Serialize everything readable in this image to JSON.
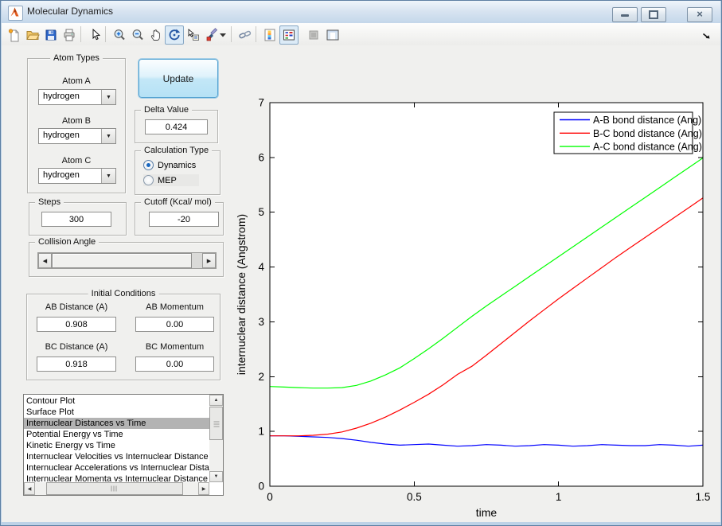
{
  "window": {
    "title": "Molecular Dynamics",
    "buttons": [
      "minimize",
      "restore",
      "close"
    ]
  },
  "toolbar": {
    "buttons": [
      "new-file",
      "open-file",
      "save",
      "print",
      "pointer",
      "zoom-in",
      "zoom-out",
      "pan",
      "rotate-3d",
      "data-cursor",
      "brush",
      "brush-dropdown",
      "link-plot",
      "insert-colorbar",
      "insert-legend",
      "hide-plot-tools",
      "show-plot-tools"
    ],
    "pressed": [
      "rotate-3d",
      "insert-legend"
    ]
  },
  "controls": {
    "atom_types": {
      "title": "Atom Types",
      "fields": [
        {
          "label": "Atom A",
          "value": "hydrogen"
        },
        {
          "label": "Atom B",
          "value": "hydrogen"
        },
        {
          "label": "Atom C",
          "value": "hydrogen"
        }
      ]
    },
    "update_button": "Update",
    "delta": {
      "title": "Delta Value",
      "value": "0.424"
    },
    "calculation_type": {
      "title": "Calculation Type",
      "options": [
        {
          "label": "Dynamics",
          "selected": true
        },
        {
          "label": "MEP",
          "selected": false
        }
      ]
    },
    "steps": {
      "title": "Steps",
      "value": "300"
    },
    "cutoff": {
      "title": "Cutoff (Kcal/ mol)",
      "value": "-20"
    },
    "collision_angle": {
      "title": "Collision Angle"
    },
    "initial_conditions": {
      "title": "Initial Conditions",
      "fields": [
        {
          "label": "AB Distance (A)",
          "value": "0.908"
        },
        {
          "label": "AB Momentum",
          "value": "0.00"
        },
        {
          "label": "BC Distance (A)",
          "value": "0.918"
        },
        {
          "label": "BC Momentum",
          "value": "0.00"
        }
      ]
    },
    "plot_list": {
      "selected_index": 2,
      "items": [
        "Contour Plot",
        "Surface Plot",
        "Internuclear Distances vs Time",
        "Potential Energy vs Time",
        "Kinetic Energy vs Time",
        "Internuclear Velocities vs Internuclear Distance",
        "Internuclear Accelerations vs Internuclear Distance",
        "Internuclear Momenta vs Internuclear Distance"
      ]
    }
  },
  "chart_data": {
    "type": "line",
    "title": "",
    "xlabel": "time",
    "ylabel": "internuclear distance (Angstrom)",
    "xlim": [
      0,
      1.5
    ],
    "ylim": [
      0,
      7
    ],
    "xticks": [
      0,
      0.5,
      1,
      1.5
    ],
    "yticks": [
      0,
      1,
      2,
      3,
      4,
      5,
      6,
      7
    ],
    "grid": false,
    "legend_position": "top-right",
    "background": "#ffffff",
    "x": [
      0,
      0.05,
      0.1,
      0.15,
      0.2,
      0.25,
      0.3,
      0.35,
      0.4,
      0.45,
      0.5,
      0.55,
      0.6,
      0.65,
      0.7,
      0.75,
      0.8,
      0.85,
      0.9,
      0.95,
      1,
      1.05,
      1.1,
      1.15,
      1.2,
      1.25,
      1.3,
      1.35,
      1.4,
      1.45,
      1.5
    ],
    "series": [
      {
        "name": "A-B bond distance (Ang)",
        "color": "#0000ff",
        "values": [
          0.92,
          0.92,
          0.91,
          0.9,
          0.89,
          0.87,
          0.84,
          0.8,
          0.77,
          0.75,
          0.76,
          0.77,
          0.75,
          0.73,
          0.74,
          0.76,
          0.75,
          0.73,
          0.74,
          0.76,
          0.75,
          0.73,
          0.74,
          0.76,
          0.75,
          0.74,
          0.74,
          0.76,
          0.75,
          0.73,
          0.75
        ]
      },
      {
        "name": "B-C bond distance (Ang)",
        "color": "#ff0000",
        "values": [
          0.92,
          0.92,
          0.92,
          0.93,
          0.95,
          0.99,
          1.06,
          1.15,
          1.26,
          1.39,
          1.53,
          1.68,
          1.85,
          2.04,
          2.19,
          2.39,
          2.6,
          2.81,
          3.02,
          3.22,
          3.42,
          3.61,
          3.8,
          3.99,
          4.18,
          4.36,
          4.54,
          4.72,
          4.9,
          5.08,
          5.26
        ]
      },
      {
        "name": "A-C bond distance (Ang)",
        "color": "#00ff00",
        "values": [
          1.82,
          1.81,
          1.8,
          1.79,
          1.79,
          1.8,
          1.84,
          1.92,
          2.03,
          2.16,
          2.33,
          2.51,
          2.7,
          2.9,
          3.1,
          3.29,
          3.47,
          3.65,
          3.83,
          4.01,
          4.19,
          4.37,
          4.55,
          4.73,
          4.91,
          5.09,
          5.27,
          5.45,
          5.63,
          5.81,
          5.99
        ]
      }
    ]
  }
}
